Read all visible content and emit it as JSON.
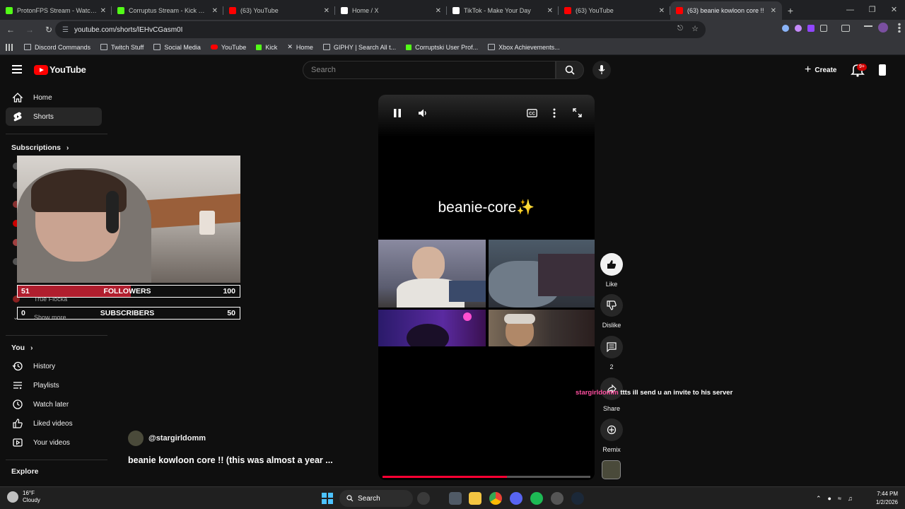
{
  "browser": {
    "tabs": [
      {
        "title": "ProtonFPS Stream - Watch Live",
        "color": "#53fc18",
        "active": false
      },
      {
        "title": "Corruptus Stream - Kick Dashb",
        "color": "#53fc18",
        "active": false
      },
      {
        "title": "(63) YouTube",
        "color": "#ff0000",
        "active": false
      },
      {
        "title": "Home / X",
        "color": "#ffffff",
        "active": false
      },
      {
        "title": "TikTok - Make Your Day",
        "color": "#ffffff",
        "active": false
      },
      {
        "title": "(63) YouTube",
        "color": "#ff0000",
        "active": false
      },
      {
        "title": "(63) beanie kowloon core !!",
        "color": "#ff0000",
        "active": true
      }
    ],
    "url": "youtube.com/shorts/lEHvCGasm0I",
    "bookmarks": [
      {
        "label": "Discord Commands",
        "icon": "folder-icon"
      },
      {
        "label": "Twitch Stuff",
        "icon": "folder-icon"
      },
      {
        "label": "Social Media",
        "icon": "folder-icon"
      },
      {
        "label": "YouTube",
        "icon": "youtube-icon"
      },
      {
        "label": "Kick",
        "icon": "kick-icon"
      },
      {
        "label": "Home",
        "icon": "x-icon"
      },
      {
        "label": "GIPHY | Search All t...",
        "icon": "giphy-icon"
      },
      {
        "label": "Corruptski User Prof...",
        "icon": "kick-icon"
      },
      {
        "label": "Xbox Achievements...",
        "icon": "xbox-icon"
      }
    ]
  },
  "youtube": {
    "logo": "YouTube",
    "search_placeholder": "Search",
    "create_label": "Create",
    "notif_badge": "9+",
    "sidebar": {
      "home": "Home",
      "shorts": "Shorts",
      "subscriptions": "Subscriptions",
      "sub_partial": "True Flocka",
      "show_more": "Show more",
      "you": "You",
      "history": "History",
      "playlists": "Playlists",
      "watch_later": "Watch later",
      "liked_videos": "Liked videos",
      "your_videos": "Your videos",
      "explore": "Explore"
    },
    "short": {
      "overlay_text": "beanie-core✨",
      "channel": "@stargirldomm",
      "title": "beanie kowloon core !! (this was almost a year ...",
      "progress": 0.6
    },
    "actions": {
      "like": "Like",
      "dislike": "Dislike",
      "comments": "2",
      "share": "Share",
      "remix": "Remix"
    }
  },
  "stream_overlay": {
    "followers": {
      "current": "51",
      "label": "FOLLOWERS",
      "goal": "100",
      "fraction": 0.51
    },
    "subscribers": {
      "current": "0",
      "label": "SUBSCRIBERS",
      "goal": "50",
      "fraction": 0.0
    },
    "chat": {
      "user": "stargirldomm",
      "message": "ttts ill send u an invite to his server"
    }
  },
  "taskbar": {
    "weather_temp": "16°F",
    "weather_desc": "Cloudy",
    "search": "Search",
    "time": "7:44 PM",
    "date": "1/2/2026"
  }
}
